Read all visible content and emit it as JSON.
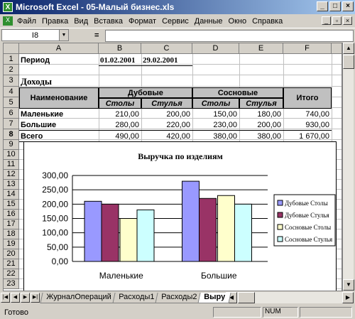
{
  "window": {
    "title": "Microsoft Excel - 05-Малый бизнес.xls",
    "app_icon": "excel-icon"
  },
  "menu": [
    "Файл",
    "Правка",
    "Вид",
    "Вставка",
    "Формат",
    "Сервис",
    "Данные",
    "Окно",
    "Справка"
  ],
  "formula_bar": {
    "name_box": "I8",
    "equals": "=",
    "formula": ""
  },
  "columns": [
    "A",
    "B",
    "C",
    "D",
    "E",
    "F"
  ],
  "rows": [
    "1",
    "2",
    "3",
    "4",
    "5",
    "6",
    "7",
    "8",
    "9",
    "10",
    "11",
    "12",
    "13",
    "14",
    "15",
    "16",
    "17",
    "18",
    "19",
    "20",
    "21",
    "22",
    "23"
  ],
  "sheet": {
    "period_label": "Период",
    "period_from": "01.02.2001",
    "period_to": "29.02.2001",
    "section_title": "Доходы",
    "header_name": "Наименование",
    "header_oak": "Дубовые",
    "header_pine": "Сосновые",
    "header_total": "Итого",
    "sub_tables": "Столы",
    "sub_chairs": "Стулья",
    "sub_tables2": "Столы",
    "sub_chairs2": "Стулья",
    "rows": [
      {
        "name": "Маленькие",
        "oak_tables": "210,00",
        "oak_chairs": "200,00",
        "pine_tables": "150,00",
        "pine_chairs": "180,00",
        "total": "740,00"
      },
      {
        "name": "Большие",
        "oak_tables": "280,00",
        "oak_chairs": "220,00",
        "pine_tables": "230,00",
        "pine_chairs": "200,00",
        "total": "930,00"
      },
      {
        "name": "Всего",
        "oak_tables": "490,00",
        "oak_chairs": "420,00",
        "pine_tables": "380,00",
        "pine_chairs": "380,00",
        "total": "1 670,00"
      }
    ]
  },
  "chart_data": {
    "type": "bar",
    "title": "Выручка по изделиям",
    "categories": [
      "Маленькие",
      "Большие"
    ],
    "series": [
      {
        "name": "Дубовые Столы",
        "values": [
          210,
          280
        ],
        "color": "#9999ff"
      },
      {
        "name": "Дубовые Стулья",
        "values": [
          200,
          220
        ],
        "color": "#993366"
      },
      {
        "name": "Сосновые Столы",
        "values": [
          150,
          230
        ],
        "color": "#ffffcc"
      },
      {
        "name": "Сосновые Стулья",
        "values": [
          180,
          200
        ],
        "color": "#ccffff"
      }
    ],
    "ylim": [
      0,
      300
    ],
    "yticks": [
      "0,00",
      "50,00",
      "100,00",
      "150,00",
      "200,00",
      "250,00",
      "300,00"
    ],
    "legend": "right",
    "grid": true
  },
  "tabs": [
    "ЖурналОпераций",
    "Расходы1",
    "Расходы2",
    "Выру"
  ],
  "active_tab": "Выру",
  "status": {
    "ready": "Готово",
    "num": "NUM"
  }
}
